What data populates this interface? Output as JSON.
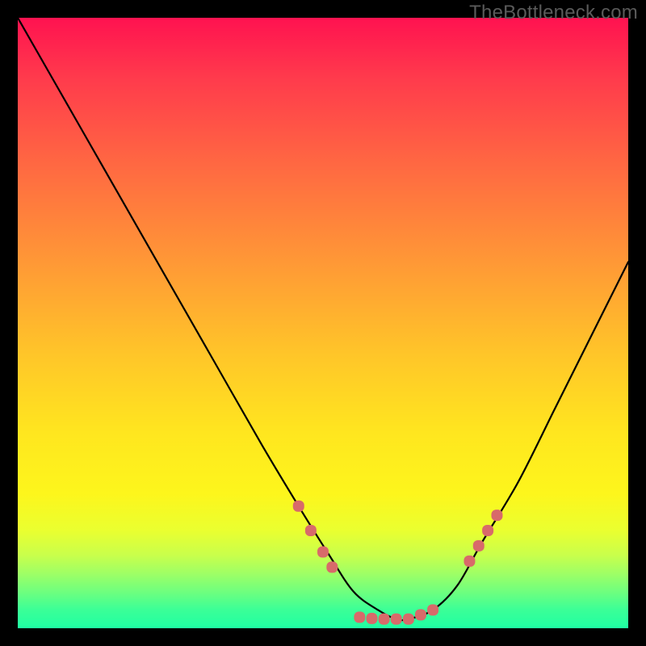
{
  "watermark": "TheBottleneck.com",
  "chart_data": {
    "type": "line",
    "title": "",
    "xlabel": "",
    "ylabel": "",
    "xlim": [
      0,
      100
    ],
    "ylim": [
      0,
      100
    ],
    "series": [
      {
        "name": "bottleneck-curve",
        "x": [
          0,
          8,
          16,
          24,
          32,
          40,
          46,
          51,
          55,
          59,
          62,
          64,
          68,
          72,
          76,
          82,
          88,
          94,
          100
        ],
        "values": [
          100,
          86,
          72,
          58,
          44,
          30,
          20,
          12,
          6,
          3,
          1.5,
          1.5,
          3,
          7,
          14,
          24,
          36,
          48,
          60
        ]
      }
    ],
    "markers": {
      "name": "highlight-markers",
      "color": "#d86a6a",
      "points": [
        {
          "x": 46,
          "y": 20
        },
        {
          "x": 48,
          "y": 16
        },
        {
          "x": 50,
          "y": 12.5
        },
        {
          "x": 51.5,
          "y": 10
        },
        {
          "x": 56,
          "y": 1.8
        },
        {
          "x": 58,
          "y": 1.6
        },
        {
          "x": 60,
          "y": 1.5
        },
        {
          "x": 62,
          "y": 1.5
        },
        {
          "x": 64,
          "y": 1.5
        },
        {
          "x": 66,
          "y": 2.2
        },
        {
          "x": 68,
          "y": 3
        },
        {
          "x": 74,
          "y": 11
        },
        {
          "x": 75.5,
          "y": 13.5
        },
        {
          "x": 77,
          "y": 16
        },
        {
          "x": 78.5,
          "y": 18.5
        }
      ]
    }
  }
}
